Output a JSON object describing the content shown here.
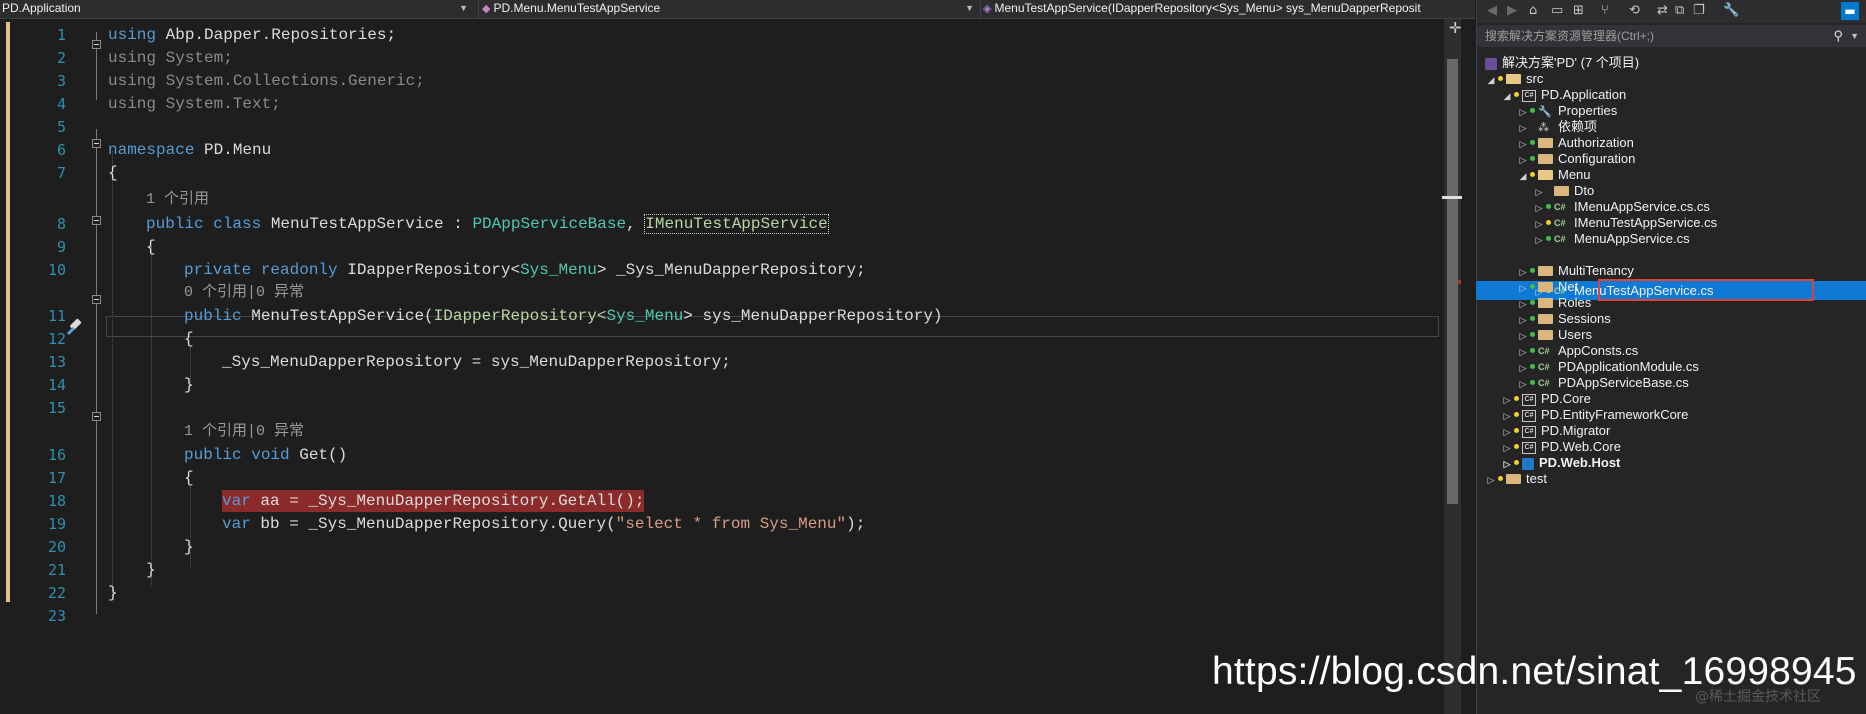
{
  "navbar": {
    "project": "PD.Application",
    "class_path": "PD.Menu.MenuTestAppService",
    "member": "MenuTestAppService(IDapperRepository<Sys_Menu> sys_MenuDapperReposit"
  },
  "editor": {
    "line_numbers": [
      "1",
      "2",
      "3",
      "4",
      "5",
      "6",
      "7",
      "8",
      "9",
      "10",
      "11",
      "12",
      "13",
      "14",
      "15",
      "16",
      "17",
      "18",
      "19",
      "20",
      "21",
      "22",
      "23"
    ],
    "codelens": {
      "class_refs": "1 个引用",
      "ctor_refs": "0 个引用|0 异常",
      "get_refs": "1 个引用|0 异常"
    },
    "code": {
      "l1": [
        "using",
        " Abp.Dapper.Repositories;"
      ],
      "l2": [
        "using",
        " System;"
      ],
      "l3": [
        "using",
        " System.Collections.Generic;"
      ],
      "l4": [
        "using",
        " System.Text;"
      ],
      "l6": [
        "namespace",
        " PD.Menu"
      ],
      "l7": "{",
      "l8": [
        "public class",
        " MenuTestAppService : ",
        "PDAppServiceBase",
        ", ",
        "IMenuTestAppService"
      ],
      "l9": "{",
      "l10": [
        "private readonly",
        " IDapperRepository<",
        "Sys_Menu",
        "> _Sys_MenuDapperRepository;"
      ],
      "l11": [
        "public",
        " MenuTestAppService(",
        "IDapperRepository<",
        "Sys_Menu",
        "> sys_MenuDapperRepository)"
      ],
      "l12": "{",
      "l13": "_Sys_MenuDapperRepository = sys_MenuDapperRepository;",
      "l14": "}",
      "l16": [
        "public void",
        " Get()"
      ],
      "l17": "{",
      "l18": [
        "var",
        " aa = _Sys_MenuDapperRepository.GetAll();"
      ],
      "l19": [
        "var",
        " bb = _Sys_MenuDapperRepository.Query(",
        "\"select * from Sys_Menu\"",
        ");"
      ],
      "l20": "}",
      "l21": "}",
      "l22": "}"
    }
  },
  "solution_explorer": {
    "search_placeholder": "搜索解决方案资源管理器(Ctrl+;)",
    "items": [
      {
        "label": "解决方案'PD' (7 个项目)"
      },
      {
        "label": "src"
      },
      {
        "label": "PD.Application"
      },
      {
        "label": "Properties"
      },
      {
        "label": "依赖项"
      },
      {
        "label": "Authorization"
      },
      {
        "label": "Configuration"
      },
      {
        "label": "Menu"
      },
      {
        "label": "Dto"
      },
      {
        "label": "IMenuAppService.cs.cs"
      },
      {
        "label": "IMenuTestAppService.cs"
      },
      {
        "label": "MenuAppService.cs"
      },
      {
        "label": "MenuTestAppService.cs"
      },
      {
        "label": "MultiTenancy"
      },
      {
        "label": "Net"
      },
      {
        "label": "Roles"
      },
      {
        "label": "Sessions"
      },
      {
        "label": "Users"
      },
      {
        "label": "AppConsts.cs"
      },
      {
        "label": "PDApplicationModule.cs"
      },
      {
        "label": "PDAppServiceBase.cs"
      },
      {
        "label": "PD.Core"
      },
      {
        "label": "PD.EntityFrameworkCore"
      },
      {
        "label": "PD.Migrator"
      },
      {
        "label": "PD.Web.Core"
      },
      {
        "label": "PD.Web.Host"
      },
      {
        "label": "test"
      }
    ]
  },
  "watermark": {
    "url": "https://blog.csdn.net/sinat_16998945",
    "faint": "@稀土掘金技术社区"
  },
  "colors": {
    "editor_bg": "#1e1e1e",
    "keyword": "#569cd6",
    "type": "#4ec9b0",
    "selection": "#0e7ad3",
    "highlight_line": "#8b2b2b",
    "annotation_box": "#e0413b"
  }
}
